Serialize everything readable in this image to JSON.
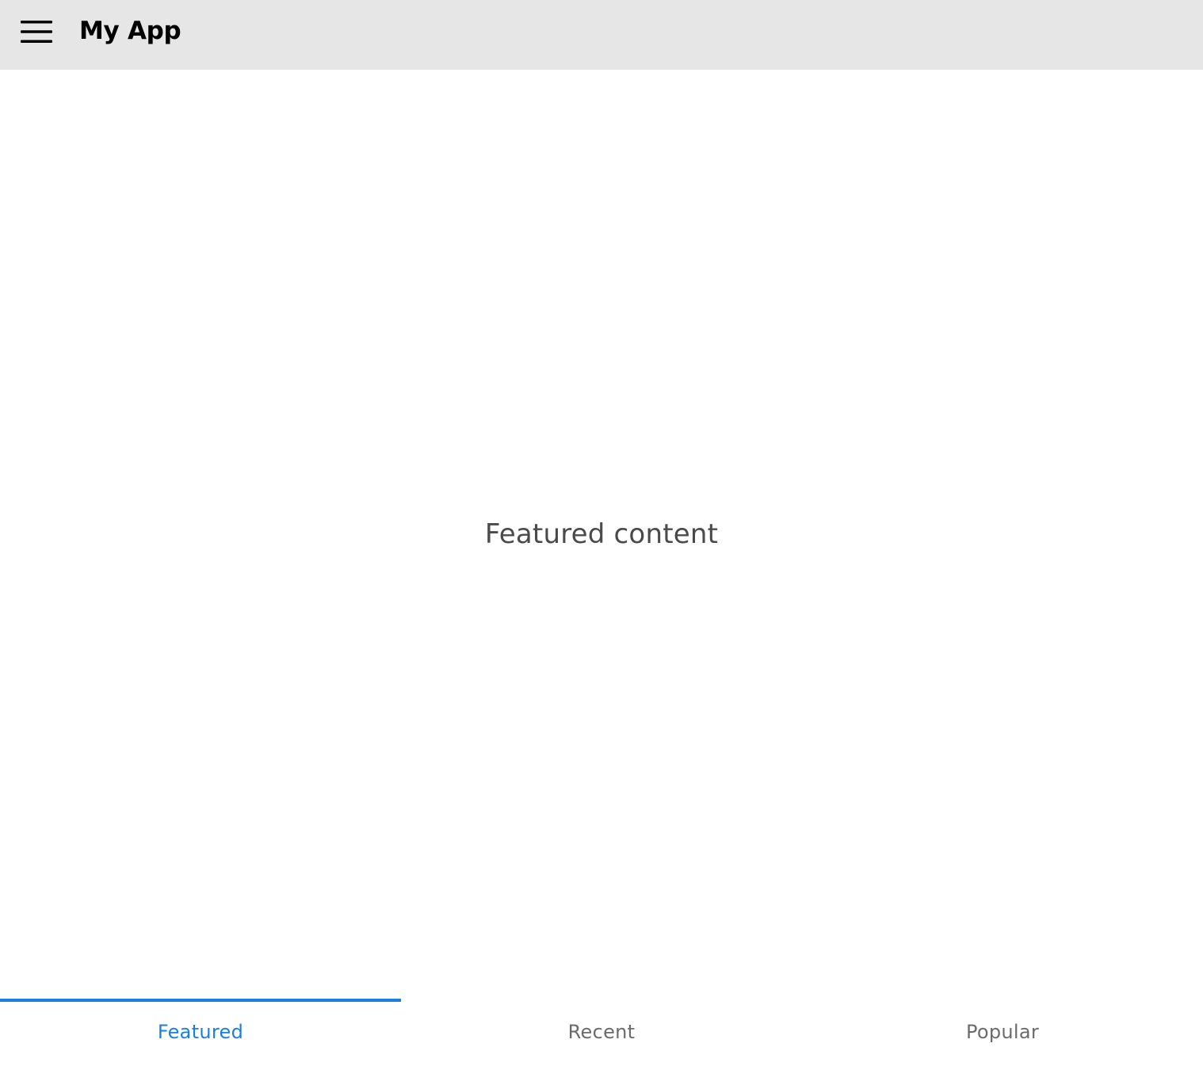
{
  "app_bar": {
    "title": "My App",
    "menu_icon": "hamburger-menu-icon",
    "background": "#e6e6e6"
  },
  "content": {
    "text": "Featured content"
  },
  "tabs": [
    {
      "label": "Featured",
      "active": true
    },
    {
      "label": "Recent",
      "active": false
    },
    {
      "label": "Popular",
      "active": false
    }
  ],
  "colors": {
    "accent": "#1a7fe0",
    "inactive_tab_text": "#6b6b6b",
    "content_text": "#4a4a4a"
  }
}
